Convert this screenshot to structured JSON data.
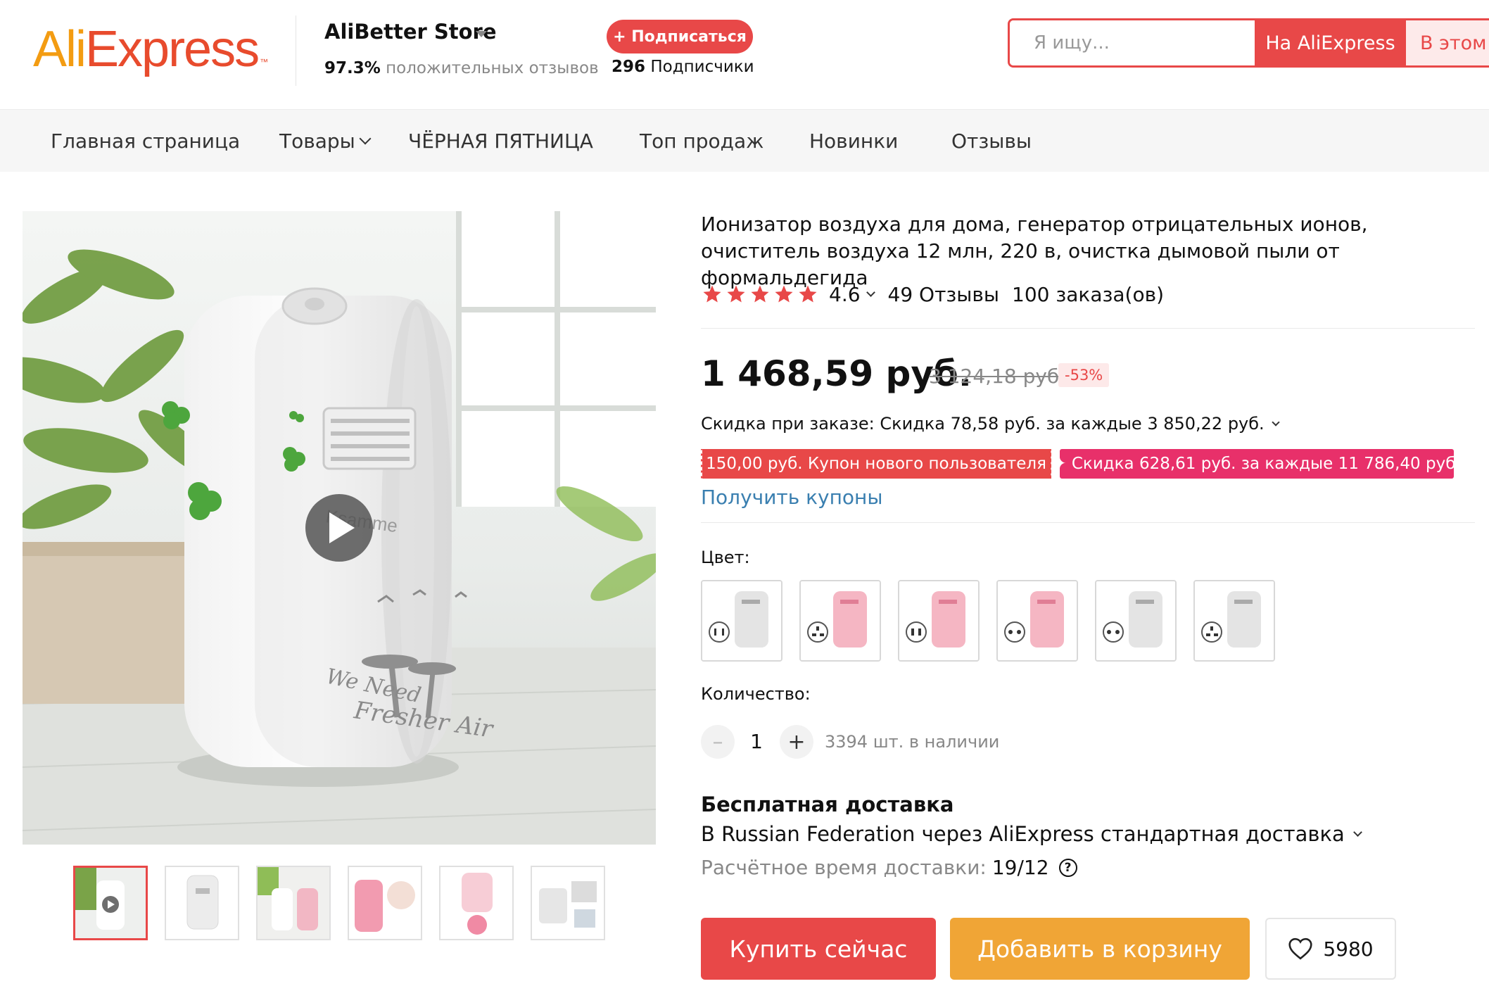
{
  "header": {
    "logo": {
      "part1": "Ali",
      "part2": "Express",
      "tm": "™"
    },
    "store": {
      "name": "AliBetter Store",
      "positive_pct": "97.3%",
      "positive_text": "положительных отзывов",
      "subscribe_label": "+ Подписаться",
      "subscribers_count": "296",
      "subscribers_text": "Подписчики"
    },
    "search": {
      "placeholder": "Я ищу...",
      "btn_all": "На AliExpress",
      "btn_store": "В этом"
    }
  },
  "nav": {
    "items": [
      {
        "label": "Главная страница"
      },
      {
        "label": "Товары",
        "has_dropdown": true
      },
      {
        "label": "ЧЁРНАЯ ПЯТНИЦА"
      },
      {
        "label": "Топ продаж"
      },
      {
        "label": "Новинки"
      },
      {
        "label": "Отзывы"
      }
    ]
  },
  "gallery": {
    "main_image": {
      "brand_text": "Ksamme",
      "slogan_line1": "We Need",
      "slogan_line2": "Fresher Air",
      "has_video": true
    },
    "thumbnails_count": 6,
    "active_thumbnail": 0
  },
  "product": {
    "title": "Ионизатор воздуха для дома, генератор отрицательных ионов, очиститель воздуха 12 млн, 220 в, очистка дымовой пыли от формальдегида",
    "rating": "4.6",
    "stars": 5,
    "reviews": "49 Отзывы",
    "orders": "100 заказа(ов)",
    "price": "1 468,59 руб.",
    "old_price": "3 124,18 руб.",
    "discount": "-53%",
    "order_discount": "Скидка при заказе: Скидка 78,58 руб. за каждые 3 850,22 руб.",
    "coupon_new_user": "150,00 руб. Купон нового пользователя",
    "coupon_store": "✦ Скидка 628,61 руб. за каждые 11 786,40 руб.",
    "get_coupons": "Получить купоны",
    "color_label": "Цвет:",
    "colors": [
      {
        "body": "gray",
        "plug": "eu"
      },
      {
        "body": "pink",
        "plug": "uk"
      },
      {
        "body": "pink",
        "plug": "us"
      },
      {
        "body": "pink",
        "plug": "eu"
      },
      {
        "body": "gray",
        "plug": "eu"
      },
      {
        "body": "gray",
        "plug": "uk"
      }
    ],
    "quantity_label": "Количество:",
    "quantity": "1",
    "qty_minus": "–",
    "qty_plus": "+",
    "stock": "3394 шт. в наличии",
    "shipping_title": "Бесплатная доставка",
    "shipping_via": "В Russian Federation через AliExpress стандартная доставка",
    "delivery_label": "Расчётное время доставки:",
    "delivery_value": "19/12",
    "help_icon": "?",
    "buy_now": "Купить сейчас",
    "add_to_cart": "Добавить в корзину",
    "wishlist_count": "5980"
  },
  "colors": {
    "accent_red": "#e84848",
    "cart_orange": "#f0a536",
    "coupon_pink": "#e8306a",
    "link_blue": "#3a7fb0"
  }
}
